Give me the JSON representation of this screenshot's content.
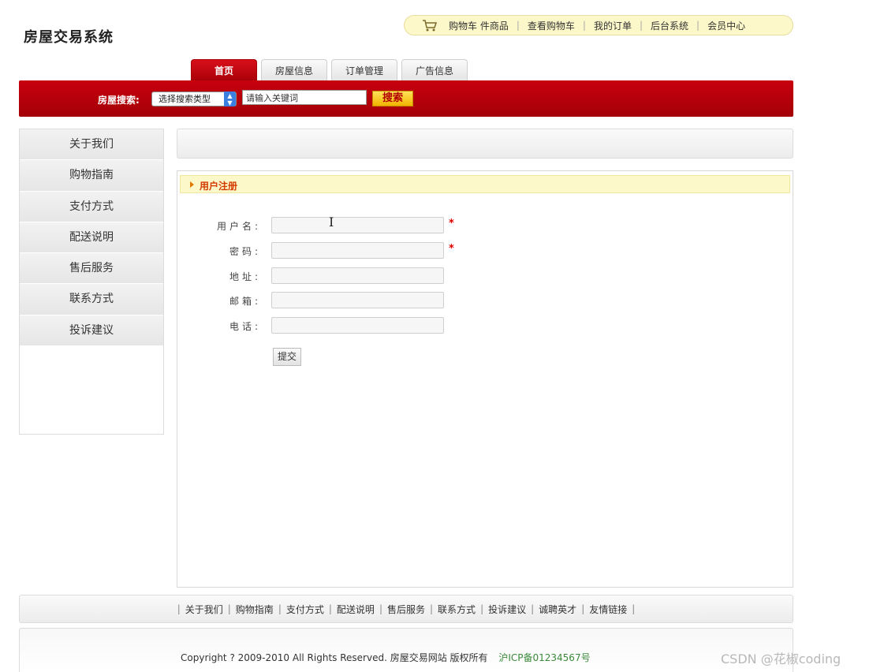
{
  "site": {
    "title": "房屋交易系统"
  },
  "top_links": {
    "cart_count_text": "购物车 件商品",
    "items": [
      "查看购物车",
      "我的订单",
      "后台系统",
      "会员中心"
    ]
  },
  "tabs": [
    "首页",
    "房屋信息",
    "订单管理",
    "广告信息"
  ],
  "search": {
    "label": "房屋搜索:",
    "select_value": "选择搜索类型",
    "input_value": "请输入关键词",
    "button": "搜索"
  },
  "sidebar": {
    "items": [
      "关于我们",
      "购物指南",
      "支付方式",
      "配送说明",
      "售后服务",
      "联系方式",
      "投诉建议"
    ]
  },
  "panel": {
    "title": "用户注册",
    "fields": [
      {
        "label": "用户名:",
        "required": true
      },
      {
        "label": "密码:",
        "required": true
      },
      {
        "label": "地址:",
        "required": false
      },
      {
        "label": "邮箱:",
        "required": false
      },
      {
        "label": "电话:",
        "required": false
      }
    ],
    "required_mark": "*",
    "submit": "提交"
  },
  "footer": {
    "links": [
      "关于我们",
      "购物指南",
      "支付方式",
      "配送说明",
      "售后服务",
      "联系方式",
      "投诉建议",
      "诚聘英才",
      "友情链接"
    ],
    "copyright": "Copyright ? 2009-2010 All Rights Reserved. 房屋交易网站 版权所有",
    "icp": "沪ICP备01234567号"
  },
  "watermark": "CSDN @花椒coding",
  "colors": {
    "brand_red": "#c8000e",
    "highlight_yellow": "#fdf8c9",
    "button_yellow": "#f2b400"
  }
}
